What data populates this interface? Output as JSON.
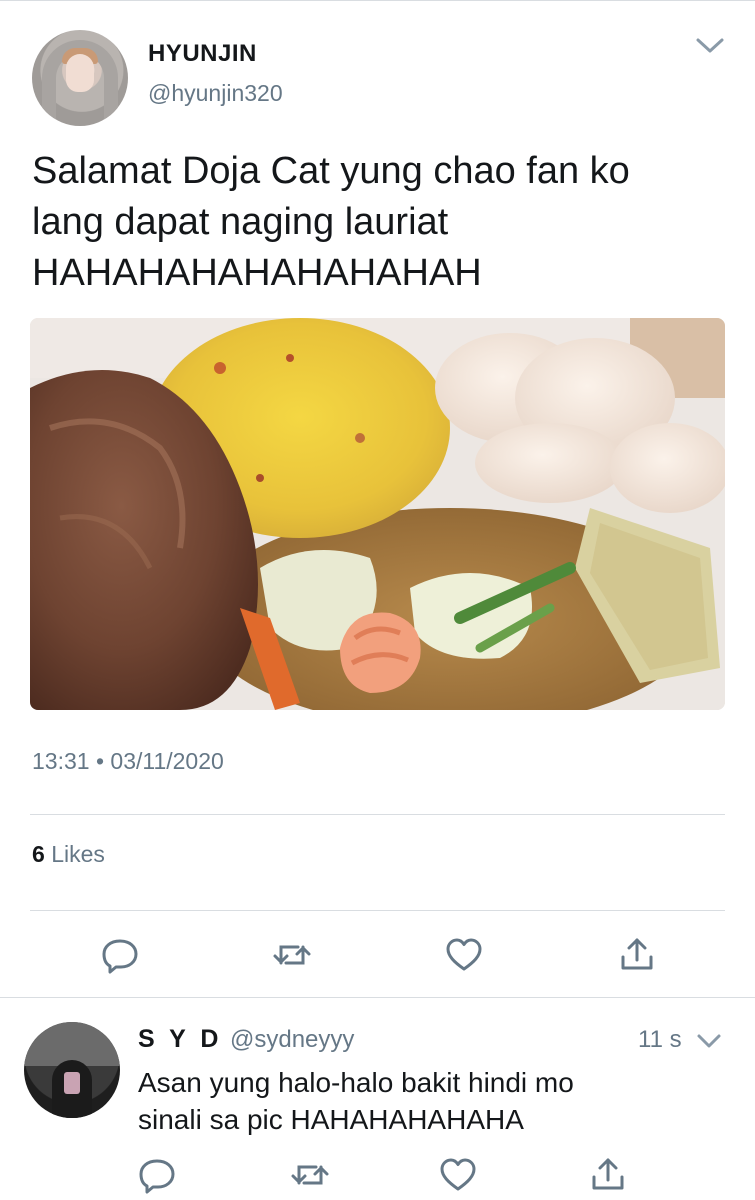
{
  "tweet": {
    "display_name": "HYUNJIN",
    "handle": "@hyunjin320",
    "text_lines": [
      "Salamat Doja Cat yung chao fan ko",
      "lang dapat naging lauriat",
      "HAHAHAHAHAHAHAHAH"
    ],
    "time": "13:31",
    "separator": "•",
    "date": "03/11/2020",
    "likes_count": "6",
    "likes_label": "Likes"
  },
  "reply": {
    "display_name": "S Y D",
    "handle": "@sydneyyy",
    "time": "11 s",
    "text_lines": [
      "Asan yung halo-halo bakit hindi mo",
      "sinali sa pic HAHAHAHAHAHA"
    ]
  },
  "icons": {
    "caret": "chevron-down-icon",
    "reply": "reply-icon",
    "retweet": "retweet-icon",
    "like": "heart-icon",
    "share": "share-icon"
  },
  "colors": {
    "text": "#14171a",
    "secondary": "#657786",
    "icon": "#657786",
    "divider": "#d9dde1"
  }
}
